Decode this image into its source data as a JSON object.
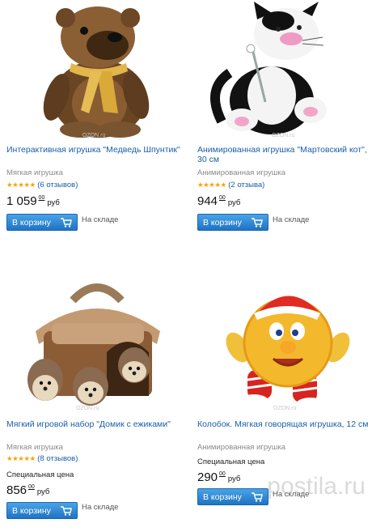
{
  "products": [
    {
      "title": "Интерактивная игрушка \"Медведь Шпунтик\"",
      "type": "Мягкая игрушка",
      "stars": "★★★★★",
      "stars_off": "",
      "reviews": "(6 отзывов)",
      "price_main": "1 059",
      "price_cents": "00",
      "currency": "руб",
      "button": "В корзину",
      "stock": "На складе",
      "watermark": "OZON.ru"
    },
    {
      "title": "Анимированная игрушка \"Мартовский кот\", 30 см",
      "type": "Анимированная игрушка",
      "stars": "★★★★★",
      "stars_off": "",
      "reviews": "(2 отзыва)",
      "price_main": "944",
      "price_cents": "00",
      "currency": "руб",
      "button": "В корзину",
      "stock": "На складе",
      "watermark": "OZON.ru"
    },
    {
      "title": "Мягкий игровой набор \"Домик с ежиками\"",
      "type": "Мягкая игрушка",
      "stars": "★★★★",
      "stars_off": "★",
      "reviews": "(8 отзывов)",
      "special": "Специальная цена",
      "price_main": "856",
      "price_cents": "00",
      "currency": "руб",
      "button": "В корзину",
      "stock": "На складе",
      "watermark": "OZON.ru"
    },
    {
      "title": "Колобок. Мягкая говорящая игрушка, 12 см",
      "type": "Анимированная игрушка",
      "special": "Специальная цена",
      "price_main": "290",
      "price_cents": "00",
      "currency": "руб",
      "button": "В корзину",
      "stock": "На складе",
      "watermark": "OZON.ru"
    }
  ],
  "page_watermark": "postila.ru",
  "colors": {
    "link": "#1a5fa8",
    "button": "#2f86d6",
    "star": "#f2a400"
  },
  "icons": [
    "cart-icon",
    "star-icon"
  ]
}
